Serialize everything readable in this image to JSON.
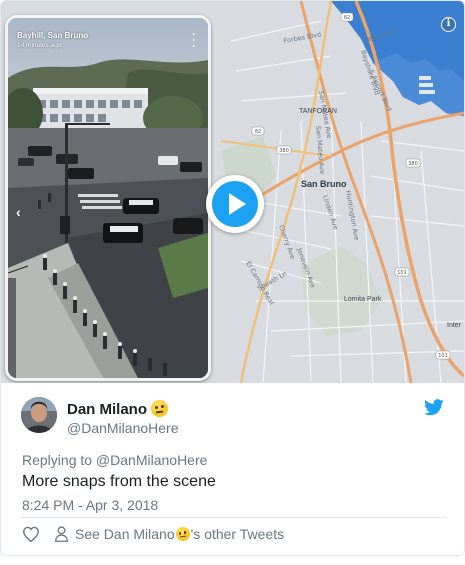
{
  "media": {
    "snap": {
      "location": "Bayhill, San Bruno",
      "time_ago": "14 minutes ago"
    },
    "map_labels": {
      "city": "San Bruno",
      "lomita_park": "Lomita Park",
      "tanforan": "TANFORAN",
      "inter": "Inter",
      "streets": [
        "San Mateo Ave",
        "Bayshore Blvd",
        "S Airport Blvd",
        "Huntington Ave",
        "Cherry Ave",
        "Linden Ave",
        "Utah Ave",
        "Forbes Blvd",
        "El Camino Real",
        "Sneath Ln",
        "Jenevein Ave"
      ],
      "route_shields": [
        "82",
        "380",
        "101",
        "280",
        "82",
        "101",
        "380"
      ]
    },
    "play_icon": "play-icon",
    "info_icon": "info-icon"
  },
  "tweet": {
    "author_name": "Dan Milano",
    "author_handle": "@DanMilanoHere",
    "replying_to": "Replying to @DanMilanoHere",
    "text": "More snaps from the scene",
    "timestamp": "8:24 PM - Apr 3, 2018",
    "see_other_prefix": "See Dan Milano",
    "see_other_suffix": "'s other Tweets",
    "emoji": "face-with-raised-eyebrow",
    "brand_color": "#1da1f2",
    "secondary_text_color": "#697882"
  }
}
